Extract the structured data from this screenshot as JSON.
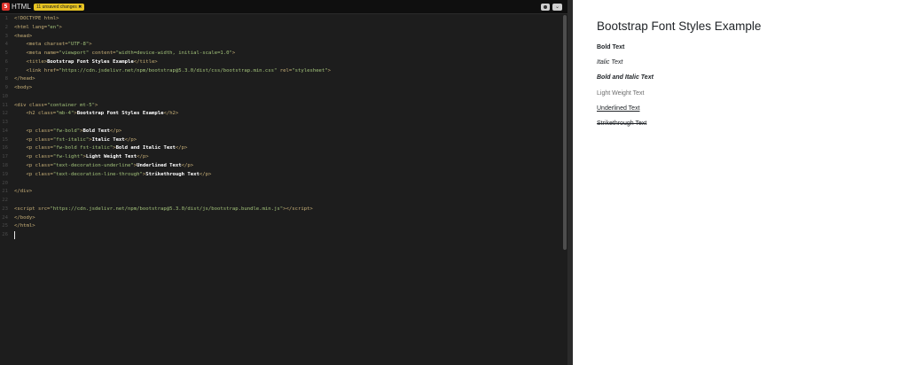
{
  "toolbar": {
    "lang_icon": "5",
    "lang_label": "HTML",
    "unsaved_badge": "11 unsaved changes ✖",
    "toggle_icon": "toggle-icon",
    "chevron_icon": "⌄"
  },
  "editor": {
    "line_numbers": [
      "1",
      "2",
      "3",
      "4",
      "5",
      "6",
      "7",
      "8",
      "9",
      "10",
      "11",
      "12",
      "13",
      "14",
      "15",
      "16",
      "17",
      "18",
      "19",
      "20",
      "21",
      "22",
      "23",
      "24",
      "25",
      "26"
    ]
  },
  "preview": {
    "heading": "Bootstrap Font Styles Example",
    "bold": "Bold Text",
    "italic": "Italic Text",
    "bold_italic": "Bold and Italic Text",
    "light": "Light Weight Text",
    "underlined": "Underlined Text",
    "strikethrough": "Strikethrough Text"
  }
}
